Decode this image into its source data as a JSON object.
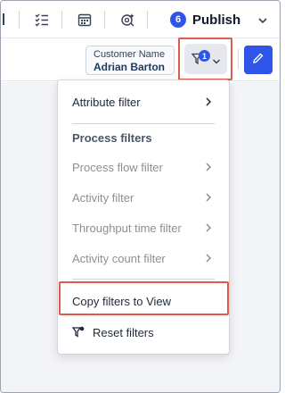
{
  "toolbar": {
    "publish": {
      "count": "6",
      "label": "Publish"
    }
  },
  "filters_bar": {
    "customer": {
      "label": "Customer Name",
      "value": "Adrian Barton"
    },
    "filter_count": "1"
  },
  "menu": {
    "attribute_filter": "Attribute filter",
    "section_title": "Process filters",
    "process_items": [
      {
        "label": "Process flow filter"
      },
      {
        "label": "Activity filter"
      },
      {
        "label": "Throughput time filter"
      },
      {
        "label": "Activity count filter"
      }
    ],
    "copy_filters": "Copy filters to View",
    "reset_filters": "Reset filters"
  },
  "colors": {
    "accent": "#2f55e8",
    "highlight_outline": "#e05a4e",
    "disabled_text": "#8b8f97"
  },
  "icons": [
    "list-check-icon",
    "calendar-icon",
    "settings-magic-icon",
    "chevron-down-icon",
    "filter-icon",
    "pencil-icon",
    "chevron-right-icon",
    "reset-filter-icon"
  ]
}
